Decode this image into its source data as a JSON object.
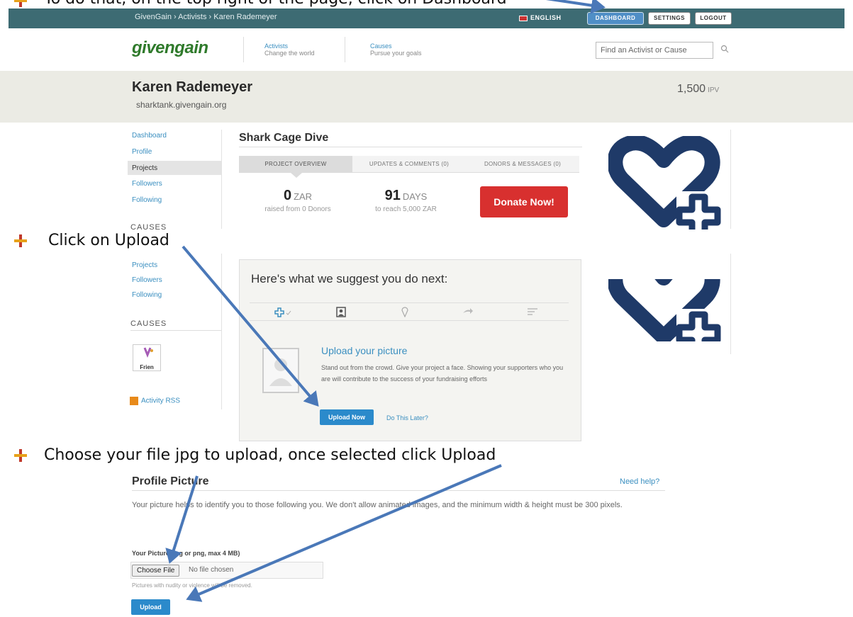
{
  "instructions": {
    "step1": "To do that, on the top right of the page, click on Dashboard",
    "step2": "Click on Upload",
    "step3": "Choose your file jpg to upload, once selected click Upload"
  },
  "topbar": {
    "breadcrumb": "GivenGain  ›  Activists  ›  Karen Rademeyer",
    "language": "ENGLISH",
    "dashboard": "DASHBOARD",
    "settings": "SETTINGS",
    "logout": "LOGOUT"
  },
  "header": {
    "logo": "givengain",
    "nav": [
      {
        "title": "Activists",
        "subtitle": "Change the world"
      },
      {
        "title": "Causes",
        "subtitle": "Pursue your goals"
      }
    ],
    "search_placeholder": "Find an Activist or Cause"
  },
  "profile": {
    "name": "Karen Rademeyer",
    "url": "sharktank.givengain.org",
    "ipv_value": "1,500",
    "ipv_unit": "IPV"
  },
  "sidebar": {
    "items": [
      "Dashboard",
      "Profile",
      "Projects",
      "Followers",
      "Following"
    ],
    "active": "Projects",
    "causes_heading_cut": "CAUSES",
    "items2": [
      "Projects",
      "Followers",
      "Following"
    ],
    "causes_heading": "CAUSES",
    "friend_label": "Frien",
    "rss": "Activity RSS"
  },
  "project": {
    "title": "Shark Cage Dive",
    "tabs": [
      "PROJECT OVERVIEW",
      "UPDATES & COMMENTS (0)",
      "DONORS & MESSAGES (0)"
    ],
    "raised_value": "0",
    "raised_unit": "ZAR",
    "raised_sub": "raised from 0 Donors",
    "days_value": "91",
    "days_unit": "DAYS",
    "days_sub": "to reach 5,000 ZAR",
    "donate": "Donate Now!"
  },
  "suggest": {
    "title": "Here's what we suggest you do next:",
    "upload_title": "Upload your picture",
    "upload_desc": "Stand out from the crowd. Give your project a face. Showing your supporters who you are will contribute to the success of your fundraising efforts",
    "upload_now": "Upload Now",
    "do_later": "Do This Later?"
  },
  "profile_picture": {
    "title": "Profile Picture",
    "help": "Need help?",
    "desc": "Your picture helps to identify you to those following you. We don't allow animated images, and the minimum width & height must be 300 pixels.",
    "label": "Your Picture (jpg or png, max 4 MB)",
    "choose": "Choose File",
    "nofile": "No file chosen",
    "note": "Pictures with nudity or violence will be removed.",
    "upload": "Upload"
  },
  "colors": {
    "topbar": "#3d6b73",
    "brand_green": "#2f7a2b",
    "link_blue": "#3b8fc0",
    "donate_red": "#d8302f",
    "arrow_blue": "#4a78b8",
    "heart_navy": "#1f3a68"
  }
}
